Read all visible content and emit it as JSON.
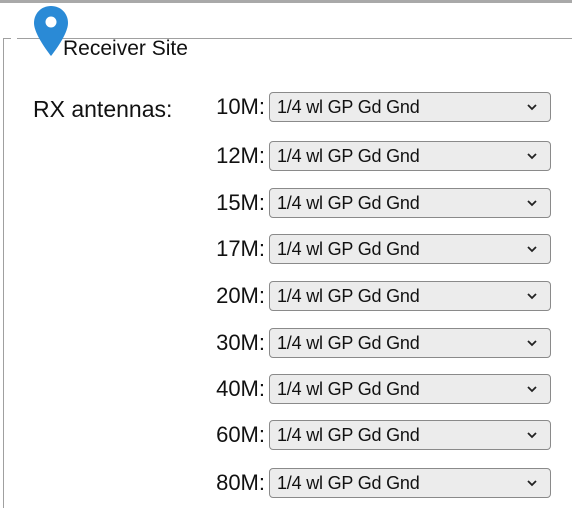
{
  "section": {
    "title": "Receiver Site",
    "icon": "map-pin-icon",
    "icon_color": "#2a8ad6"
  },
  "rx_antennas": {
    "label": "RX antennas:",
    "bands": [
      {
        "band": "10M:",
        "value": "1/4 wl GP Gd Gnd"
      },
      {
        "band": "12M:",
        "value": "1/4 wl GP Gd Gnd"
      },
      {
        "band": "15M:",
        "value": "1/4 wl GP Gd Gnd"
      },
      {
        "band": "17M:",
        "value": "1/4 wl GP Gd Gnd"
      },
      {
        "band": "20M:",
        "value": "1/4 wl GP Gd Gnd"
      },
      {
        "band": "30M:",
        "value": "1/4 wl GP Gd Gnd"
      },
      {
        "band": "40M:",
        "value": "1/4 wl GP Gd Gnd"
      },
      {
        "band": "60M:",
        "value": "1/4 wl GP Gd Gnd"
      },
      {
        "band": "80M:",
        "value": "1/4 wl GP Gd Gnd"
      }
    ]
  },
  "dropdown_icon": "chevron-down-icon"
}
